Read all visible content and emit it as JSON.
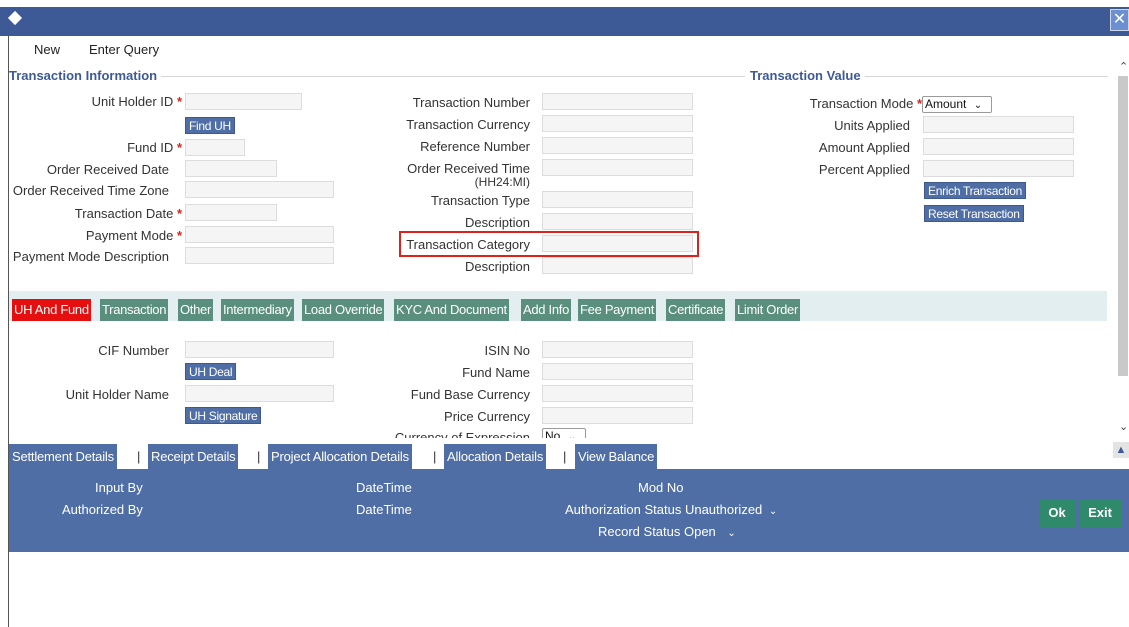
{
  "window": {
    "close_glyph": "✕"
  },
  "toolbar": {
    "new": "New",
    "enter_query": "Enter Query"
  },
  "sections": {
    "transaction_info": "Transaction Information",
    "transaction_value": "Transaction Value"
  },
  "left": {
    "unit_holder_id": "Unit Holder ID",
    "find_uh": "Find UH",
    "fund_id": "Fund ID",
    "order_received_date": "Order Received Date",
    "order_received_tz": "Order Received Time Zone",
    "transaction_date": "Transaction Date",
    "payment_mode": "Payment Mode",
    "payment_mode_desc": "Payment Mode Description",
    "required_mark": "*"
  },
  "middle": {
    "transaction_number": "Transaction Number",
    "transaction_currency": "Transaction Currency",
    "reference_number": "Reference Number",
    "order_received_time": "Order Received Time",
    "order_received_time_fmt": "(HH24:MI)",
    "transaction_type": "Transaction Type",
    "description1": "Description",
    "transaction_category": "Transaction Category",
    "description2": "Description"
  },
  "right": {
    "transaction_mode": "Transaction Mode",
    "transaction_mode_value": "Amount",
    "units_applied": "Units Applied",
    "amount_applied": "Amount Applied",
    "percent_applied": "Percent Applied",
    "enrich": "Enrich Transaction",
    "reset": "Reset Transaction"
  },
  "tabs": {
    "uh_and_fund": "UH And Fund",
    "transaction": "Transaction",
    "other": "Other",
    "intermediary": "Intermediary",
    "load_override": "Load Override",
    "kyc": "KYC And Document",
    "add_info": "Add Info",
    "fee_payment": "Fee Payment",
    "certificate": "Certificate",
    "limit_order": "Limit Order"
  },
  "tab_content": {
    "cif_number": "CIF Number",
    "uh_deal": "UH Deal",
    "unit_holder_name": "Unit Holder Name",
    "uh_signature": "UH Signature",
    "isin_no": "ISIN No",
    "fund_name": "Fund Name",
    "fund_base_currency": "Fund Base Currency",
    "price_currency": "Price Currency",
    "currency_of_expression": "Currency of Expression",
    "currency_of_expression_value": "No"
  },
  "bottom_tabs": {
    "settlement": "Settlement Details",
    "receipt": "Receipt Details",
    "project_allocation": "Project Allocation Details",
    "allocation": "Allocation Details",
    "view_balance": "View Balance",
    "separator": "|"
  },
  "footer": {
    "input_by": "Input By",
    "datetime1": "DateTime",
    "mod_no": "Mod No",
    "authorized_by": "Authorized By",
    "datetime2": "DateTime",
    "auth_status": "Authorization Status Unauthorized",
    "record_status": "Record Status Open",
    "ok": "Ok",
    "exit": "Exit"
  },
  "icons": {
    "dropdown": "chevron-down-icon",
    "scroll_up": "scroll-up-icon",
    "scroll_down": "scroll-down-icon"
  },
  "colors": {
    "header": "#3d5a96",
    "button": "#4f6ea6",
    "tab": "#5a8f7d",
    "active_tab": "#e60f0f",
    "required": "#e0201a",
    "ok": "#2e8a6a"
  }
}
